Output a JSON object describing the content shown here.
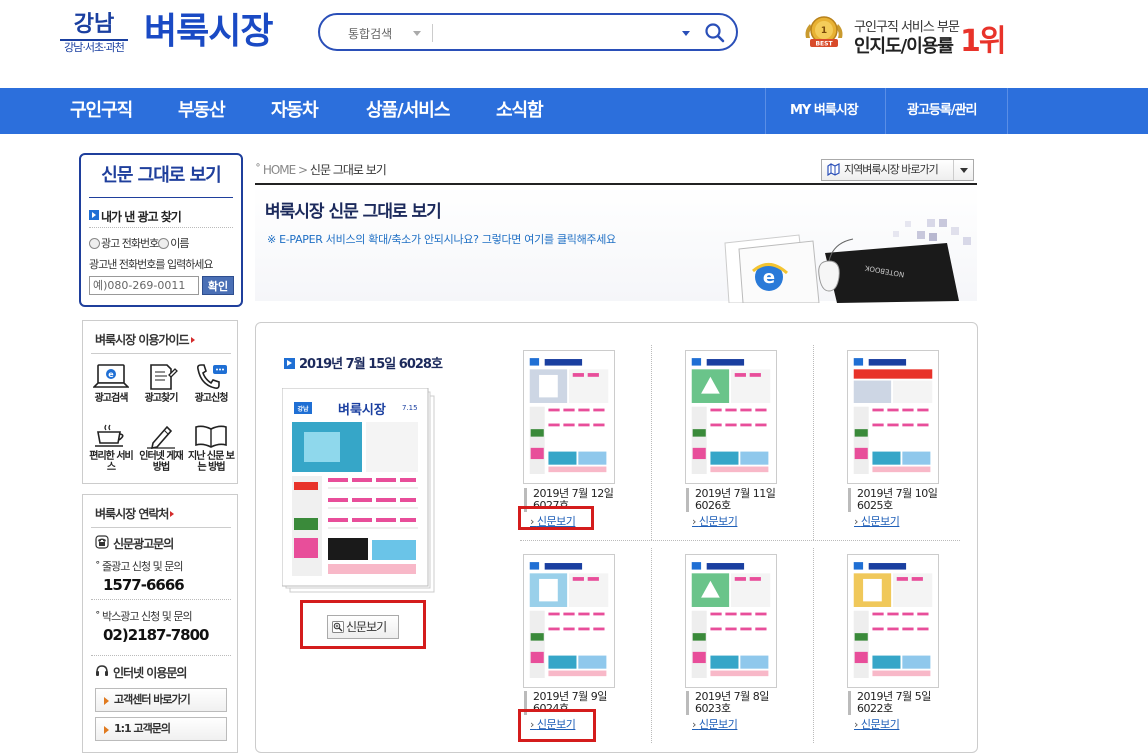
{
  "header": {
    "logo_region": "강남",
    "logo_region_sub": "강남·서초·과천",
    "logo_title": "벼룩시장",
    "search_category": "통합검색",
    "search_placeholder": "",
    "award_line1": "구인구직 서비스 부문",
    "award_line2": "인지도/이용률",
    "award_rank": "1위",
    "award_medal": "BEST"
  },
  "nav": {
    "items": [
      "구인구직",
      "부동산",
      "자동차",
      "상품/서비스",
      "소식함"
    ],
    "right_items": [
      "MY 벼룩시장",
      "광고등록/관리"
    ]
  },
  "sidebar": {
    "newspaper_view_title": "신문 그대로 보기",
    "find_ad_label": "내가 낸 광고 찾기",
    "radio_phone": "광고 전화번호",
    "radio_name": "이름",
    "hint": "광고낸 전화번호를 입력하세요",
    "phone_placeholder": "예)080-269-0011",
    "confirm_label": "확인",
    "guide_title": "벼룩시장 이용가이드",
    "guide_items": [
      {
        "icon": "laptop-search-icon",
        "label": "광고검색"
      },
      {
        "icon": "document-pen-icon",
        "label": "광고찾기"
      },
      {
        "icon": "phone-icon",
        "label": "광고신청"
      },
      {
        "icon": "coffee-cup-icon",
        "label": "편리한 서비스"
      },
      {
        "icon": "pencil-write-icon",
        "label": "인터넷 게재방법"
      },
      {
        "icon": "open-book-icon",
        "label": "지난 신문 보는 방법"
      }
    ],
    "contact_title": "벼룩시장 연락처",
    "newspaper_inquiry": "신문광고문의",
    "line_ad_label": "줄광고 신청 및 문의",
    "line_ad_phone": "1577-6666",
    "box_ad_label": "박스광고 신청 및 문의",
    "box_ad_phone": "02)2187-7800",
    "internet_inquiry": "인터넷 이용문의",
    "customer_center_btn": "고객센터 바로가기",
    "one_on_one_btn": "1:1 고객문의"
  },
  "content": {
    "breadcrumb_home": "HOME",
    "breadcrumb_current": "신문 그대로 보기",
    "region_shortcut": "지역벼룩시장 바로가기",
    "hero_title": "벼룩시장 신문 그대로 보기",
    "hero_subtitle": "※ E-PAPER 서비스의 확대/축소가 안되시나요? 그렇다면 여기를 클릭해주세요",
    "hero_notebook_label": "NOTEBOOK",
    "featured_issue": "2019년 7월 15일 6028호",
    "featured_mast_region": "강남",
    "featured_mast_title": "벼룩시장",
    "featured_mast_date": "7.15",
    "featured_btn": "신문보기",
    "issues": [
      {
        "caption": "2019년 7월 12일 6027호",
        "link": "신문보기"
      },
      {
        "caption": "2019년 7월 11일 6026호",
        "link": "신문보기"
      },
      {
        "caption": "2019년 7월 10일 6025호",
        "link": "신문보기"
      },
      {
        "caption": "2019년 7월 9일 6024호",
        "link": "신문보기"
      },
      {
        "caption": "2019년 7월 8일 6023호",
        "link": "신문보기"
      },
      {
        "caption": "2019년 7월 5일 6022호",
        "link": "신문보기"
      }
    ]
  },
  "colors": {
    "brand_blue": "#2c6fdc",
    "navy": "#1f3f9c",
    "highlight_red": "#d41c1c",
    "rank_red": "#e8332a"
  }
}
